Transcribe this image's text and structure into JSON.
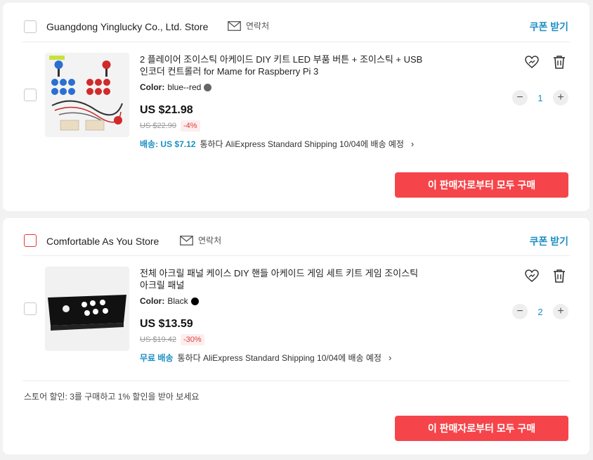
{
  "stores": [
    {
      "name": "Guangdong Yinglucky Co., Ltd. Store",
      "contact_label": "연락처",
      "coupon_label": "쿠폰 받기",
      "item": {
        "title_line1": "2 플레이어 조이스틱 아케이드 DIY 키트 LED 부품 버튼 + 조이스틱 + USB",
        "title_line2": "인코더 컨트롤러 for Mame for Raspberry Pi 3",
        "color_label": "Color:",
        "color_value": "blue--red",
        "color_swatch": "#666666",
        "price": "US $21.98",
        "original_price": "US $22.90",
        "discount": "-4%",
        "shipping_label": "배송: US $7.12",
        "shipping_text": "통하다 AliExpress Standard Shipping 10/04에 배송 예정",
        "quantity": "1"
      },
      "buy_all_label": "이 판매자로부터 모두 구매"
    },
    {
      "name": "Comfortable As You Store",
      "contact_label": "연락처",
      "coupon_label": "쿠폰 받기",
      "item": {
        "title_line1": "전체 아크릴 패널 케이스 DIY 핸들 아케이드 게임 세트 키트 게임 조이스틱",
        "title_line2": "아크릴 패널",
        "color_label": "Color:",
        "color_value": "Black",
        "color_swatch": "#000000",
        "price": "US $13.59",
        "original_price": "US $19.42",
        "discount": "-30%",
        "shipping_label": "무료 배송",
        "shipping_text": "통하다 AliExpress Standard Shipping 10/04에 배송 예정",
        "quantity": "2"
      },
      "promo_text": "스토어 할인: 3를 구매하고 1% 할인을 받아 보세요",
      "buy_all_label": "이 판매자로부터 모두 구매"
    }
  ],
  "icons": {
    "contact": "mail-icon",
    "favorite": "heart-icon",
    "delete": "trash-icon",
    "more": "chevron-right-icon",
    "decrease": "minus-icon",
    "increase": "plus-icon"
  },
  "colors": {
    "accent_blue": "#1b8fc4",
    "buy_button": "#f5454a",
    "discount_red": "#e23b3b"
  }
}
